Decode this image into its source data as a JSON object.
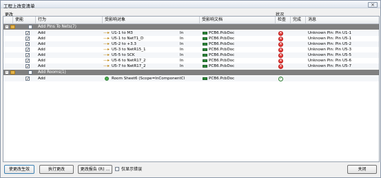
{
  "window": {
    "title": "工程上改变清单",
    "close_label": "×"
  },
  "groups": {
    "changes_label": "更改",
    "status_label": "状况"
  },
  "columns": {
    "enable": "使能",
    "action": "行为",
    "affected_object": "受影响对象",
    "affected_document": "受影响文档",
    "check": "检查",
    "done": "完成",
    "message": "消息"
  },
  "sections": [
    {
      "title": "Add Pins To Nets(7)",
      "expander": "-",
      "rows": [
        {
          "checked": "✓",
          "action": "Add",
          "object": "U1-1 to M3",
          "in": "In",
          "document": "PCB6.PcbDoc",
          "check": "error",
          "message": "Unknown Pin: Pin U1-1"
        },
        {
          "checked": "✓",
          "action": "Add",
          "object": "U5-1 to NetT1_D",
          "in": "In",
          "document": "PCB6.PcbDoc",
          "check": "error",
          "message": "Unknown Pin: Pin U5-1"
        },
        {
          "checked": "✓",
          "action": "Add",
          "object": "U5-2 to +3.3",
          "in": "In",
          "document": "PCB6.PcbDoc",
          "check": "error",
          "message": "Unknown Pin: Pin U5-2"
        },
        {
          "checked": "✓",
          "action": "Add",
          "object": "U5-3 to NetR15_1",
          "in": "In",
          "document": "PCB6.PcbDoc",
          "check": "error",
          "message": "Unknown Pin: Pin U5-3"
        },
        {
          "checked": "✓",
          "action": "Add",
          "object": "U5-5 to SCK",
          "in": "In",
          "document": "PCB6.PcbDoc",
          "check": "error",
          "message": "Unknown Pin: Pin U5-5"
        },
        {
          "checked": "✓",
          "action": "Add",
          "object": "U5-6 to NetR17_2",
          "in": "In",
          "document": "PCB6.PcbDoc",
          "check": "error",
          "message": "Unknown Pin: Pin U5-6"
        },
        {
          "checked": "✓",
          "action": "Add",
          "object": "U5-7 to NetR17_2",
          "in": "In",
          "document": "PCB6.PcbDoc",
          "check": "error",
          "message": "Unknown Pin: Pin U5-7"
        }
      ]
    },
    {
      "title": "Add Rooms(1)",
      "expander": "-",
      "rows": [
        {
          "checked": "✓",
          "action": "Add",
          "object": "Room Sheet6 (Scope=InComponentClass To",
          "in": "",
          "document": "PCB6.PcbDoc",
          "check": "ok",
          "message": ""
        }
      ]
    }
  ],
  "buttons": {
    "validate": "使更改生效",
    "execute": "执行更改",
    "report": "更改报告 (R) ...",
    "only_errors": "仅显示错误",
    "close": "关闭"
  },
  "icons": {
    "error": "error-icon",
    "ok": "ok-icon",
    "doc": "pcb-document-icon",
    "arrow": "pin-arrow-icon",
    "room": "room-icon",
    "folder": "folder-icon"
  },
  "colors": {
    "group_row": "#808080",
    "error": "#e53935",
    "ok": "#2e7d32",
    "doc": "#2e8b3a"
  }
}
